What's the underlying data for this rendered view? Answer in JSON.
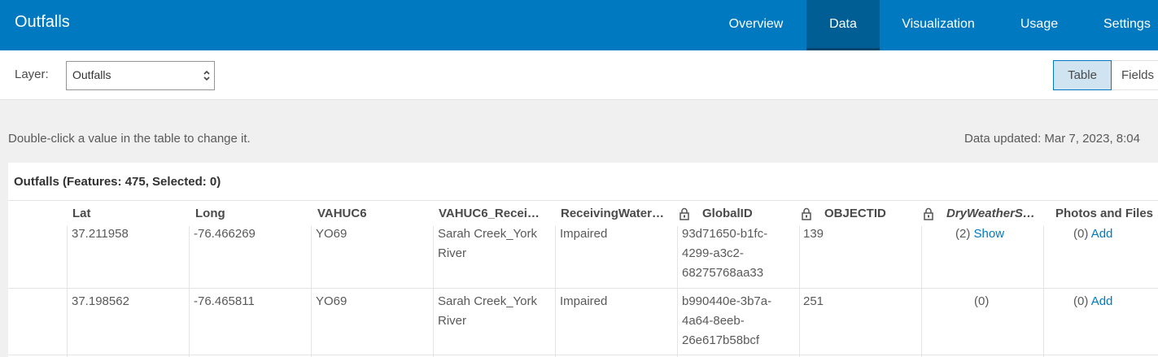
{
  "app": {
    "title": "Outfalls"
  },
  "nav": [
    {
      "label": "Overview",
      "active": false
    },
    {
      "label": "Data",
      "active": true
    },
    {
      "label": "Visualization",
      "active": false
    },
    {
      "label": "Usage",
      "active": false
    },
    {
      "label": "Settings",
      "active": false
    }
  ],
  "layer": {
    "label": "Layer:",
    "selected": "Outfalls"
  },
  "view_toggle": {
    "table_label": "Table",
    "fields_label": "Fields",
    "active": "Table"
  },
  "hint": "Double-click a value in the table to change it.",
  "updated": "Data updated: Mar 7, 2023, 8:04",
  "table": {
    "title": "Outfalls (Features: 475, Selected: 0)",
    "columns": [
      "Lat",
      "Long",
      "VAHUC6",
      "VAHUC6_Recei…",
      "ReceivingWater…",
      "GlobalID",
      "OBJECTID",
      "DryWeatherS…",
      "Photos and Files"
    ],
    "locked_columns": [
      "GlobalID",
      "OBJECTID",
      "DryWeatherS…"
    ],
    "rows": [
      {
        "lat": "37.211958",
        "long": "-76.466269",
        "vahuc6": "YO69",
        "receiving_line1": "Sarah Creek_York",
        "receiving_line2": "River",
        "water": "Impaired",
        "gid1": "93d71650-b1fc-",
        "gid2": "4299-a3c2-",
        "gid3": "68275768aa33",
        "objectid": "139",
        "dry_count": "(2)",
        "dry_link": "Show",
        "photos_count": "(0)",
        "photos_link": "Add"
      },
      {
        "lat": "37.198562",
        "long": "-76.465811",
        "vahuc6": "YO69",
        "receiving_line1": "Sarah Creek_York",
        "receiving_line2": "River",
        "water": "Impaired",
        "gid1": "b990440e-3b7a-",
        "gid2": "4a64-8eeb-",
        "gid3": "26e617b58bcf",
        "objectid": "251",
        "dry_count": "(0)",
        "dry_link": "",
        "photos_count": "(0)",
        "photos_link": "Add"
      }
    ]
  },
  "colors": {
    "brand": "#0079c1",
    "brand_dark": "#005e95",
    "link": "#0079c1"
  }
}
